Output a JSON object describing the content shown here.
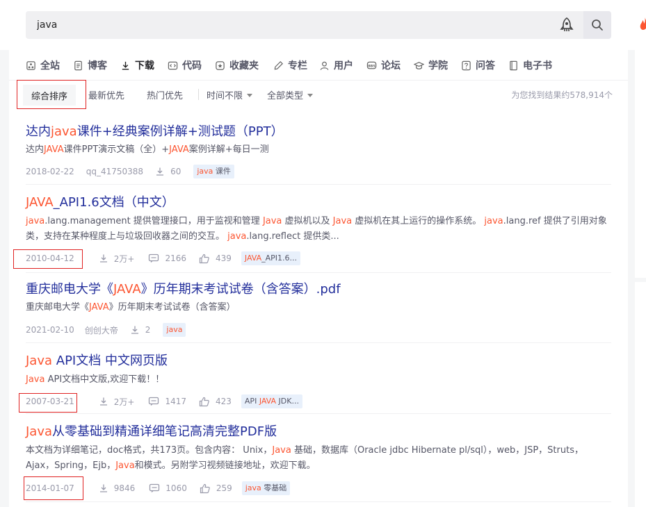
{
  "search": {
    "value": "java"
  },
  "tabs": [
    {
      "label": "全站",
      "icon": "site-icon"
    },
    {
      "label": "博客",
      "icon": "blog-icon"
    },
    {
      "label": "下载",
      "icon": "download-icon"
    },
    {
      "label": "代码",
      "icon": "code-icon"
    },
    {
      "label": "收藏夹",
      "icon": "favorites-icon"
    },
    {
      "label": "专栏",
      "icon": "column-icon"
    },
    {
      "label": "用户",
      "icon": "user-icon"
    },
    {
      "label": "论坛",
      "icon": "forum-icon"
    },
    {
      "label": "学院",
      "icon": "academy-icon"
    },
    {
      "label": "问答",
      "icon": "qa-icon"
    },
    {
      "label": "电子书",
      "icon": "ebook-icon"
    }
  ],
  "filters": {
    "sort_comprehensive": "综合排序",
    "sort_latest": "最新优先",
    "sort_hot": "热门优先",
    "time": "时间不限",
    "type": "全部类型",
    "count": "为您找到结果约578,914个"
  },
  "results": [
    {
      "title_pre": "达内",
      "title_hl": "java",
      "title_post": "课件+经典案例详解+测试题（PPT）",
      "desc_html": "达内<span class=\"hl\">JAVA</span>课件PPT演示文稿（全）+<span class=\"hl\">JAVA</span>案例详解+每日一测",
      "date": "2018-02-22",
      "author": "qq_41750388",
      "downloads": "60",
      "tag_hl": "java",
      "tag_rest": " 课件"
    },
    {
      "title_pre": "",
      "title_hl": "JAVA",
      "title_post": "_API1.6文档（中文）",
      "desc_html": "<span class=\"hl\">java</span>.lang.management 提供管理接口，用于监视和管理 <span class=\"hl\">Java</span> 虚拟机以及 <span class=\"hl\">Java</span> 虚拟机在其上运行的操作系统。 <span class=\"hl\">java</span>.lang.ref 提供了引用对象类，支持在某种程度上与垃圾回收器之间的交互。 <span class=\"hl\">java</span>.lang.reflect 提供类...",
      "date": "2010-04-12",
      "downloads": "2万+",
      "comments": "2166",
      "likes": "439",
      "tag_hl": "JAVA",
      "tag_rest": "_API1.6..."
    },
    {
      "title_pre": "重庆邮电大学《",
      "title_hl": "JAVA",
      "title_post": "》历年期末考试试卷（含答案）.pdf",
      "desc_html": "重庆邮电大学《<span class=\"hl\">JAVA</span>》历年期末考试试卷（含答案）",
      "date": "2021-02-10",
      "author": "创创大帝",
      "downloads": "2",
      "tag_hl": "java",
      "tag_rest": ""
    },
    {
      "title_pre": "",
      "title_hl": "Java",
      "title_post": " API文档 中文网页版",
      "desc_html": "<span class=\"hl\">Java</span> API文档中文版,欢迎下载！！",
      "date": "2007-03-21",
      "downloads": "2万+",
      "comments": "1417",
      "likes": "423",
      "tag_pre": "API ",
      "tag_hl": "JAVA",
      "tag_rest": " JDK..."
    },
    {
      "title_pre": "",
      "title_hl": "Java",
      "title_post": "从零基础到精通详细笔记高清完整PDF版",
      "desc_html": "本文档为详细笔记，doc格式，共173页。包含内容： Unix，<span class=\"hl\">Java</span> 基础，数据库（Oracle jdbc Hibernate pl/sql），web，JSP，Struts，Ajax，Spring，Ejb，<span class=\"hl\">Java</span>和模式。另附学习视频链接地址，欢迎下载。",
      "date": "2014-01-07",
      "downloads": "9846",
      "comments": "1060",
      "likes": "259",
      "tag_hl": "java",
      "tag_rest": " 零基础"
    }
  ]
}
